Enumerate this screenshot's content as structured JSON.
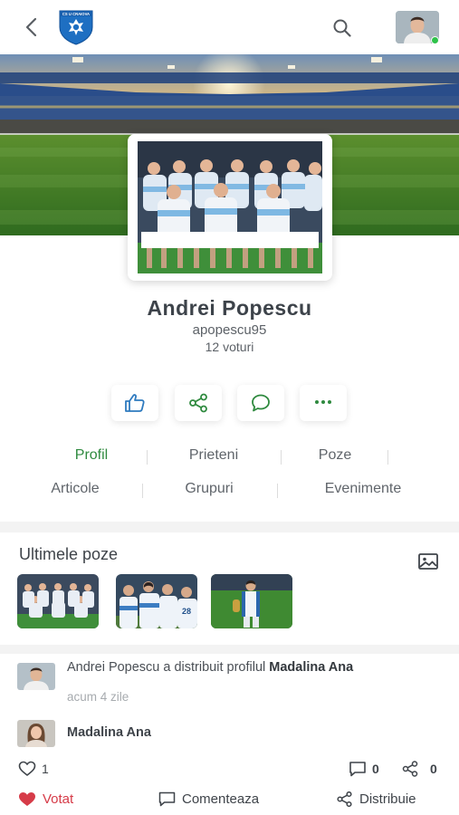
{
  "header": {
    "back_icon": "chevron-left-icon",
    "logo_text": "CS U CRAIOVA",
    "search_icon": "search-icon",
    "user_status": "online"
  },
  "profile": {
    "name": "Andrei Popescu",
    "username": "apopescu95",
    "votes": "12 voturi",
    "actions": [
      "thumbs-up-icon",
      "share-icon",
      "message-icon",
      "more-icon"
    ]
  },
  "tabs": {
    "row1": [
      "Profil",
      "Prieteni",
      "Poze"
    ],
    "row2": [
      "Articole",
      "Grupuri",
      "Evenimente"
    ],
    "active": "Profil"
  },
  "photos": {
    "title": "Ultimele poze",
    "gallery_icon": "image-icon"
  },
  "activity": {
    "actor": "Andrei Popescu",
    "action_text": " a distribuit profilul ",
    "target": "Madalina Ana",
    "time": "acum 4 zile",
    "shared_user": "Madalina Ana",
    "likes": "1",
    "comments": "0",
    "shares": "0",
    "vote_label": "Votat",
    "comment_label": "Comenteaza",
    "share_label": "Distribuie"
  },
  "colors": {
    "accent_green": "#2f8a3f",
    "action_icon_blue": "#2f7bbf",
    "action_icon_green": "#2f8a3f",
    "voted_red": "#d63b48",
    "online": "#2ec24a"
  }
}
